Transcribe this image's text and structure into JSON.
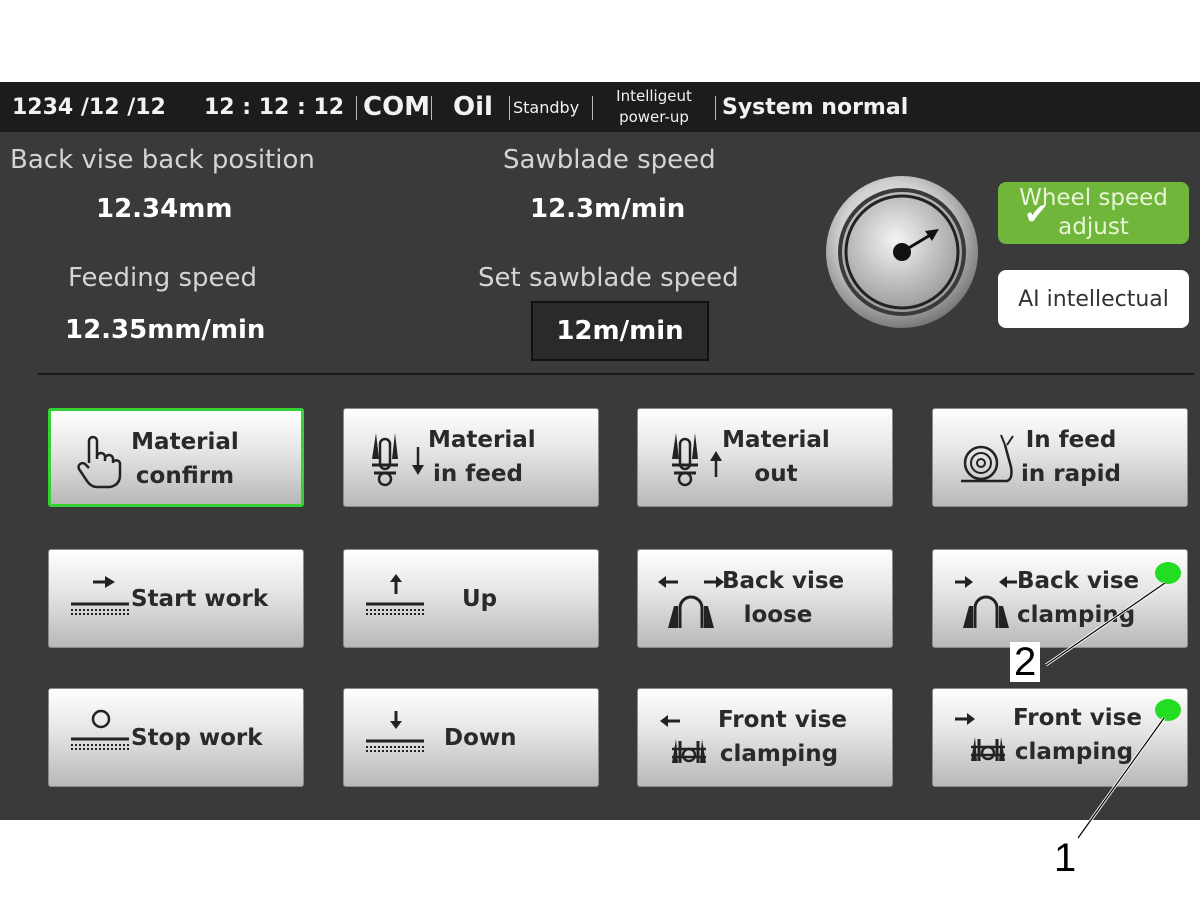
{
  "status_bar": {
    "date": "1234 /12 /12",
    "time": "12 : 12 : 12",
    "com": "COM",
    "oil": "Oil",
    "standby": "Standby",
    "power_up_line1": "Intelligeut",
    "power_up_line2": "power-up",
    "system": "System normal"
  },
  "readouts": {
    "back_vise_label": "Back vise back position",
    "back_vise_value": "12.34mm",
    "sawblade_label": "Sawblade speed",
    "sawblade_value": "12.3m/min",
    "feeding_label": "Feeding speed",
    "feeding_value": "12.35mm/min",
    "set_sawblade_label": "Set sawblade speed",
    "set_sawblade_value": "12m/min"
  },
  "side_buttons": {
    "wheel_line1": "Wheel speed",
    "wheel_line2": "adjust",
    "ai": "AI intellectual"
  },
  "buttons": [
    {
      "line1": "Material",
      "line2": "confirm",
      "icon": "hand-pointer-icon"
    },
    {
      "line1": "Material",
      "line2": "in feed",
      "icon": "material-in-icon"
    },
    {
      "line1": "Material",
      "line2": "out",
      "icon": "material-out-icon"
    },
    {
      "line1": "In feed",
      "line2": "in rapid",
      "icon": "snail-icon"
    },
    {
      "line1": "Start work",
      "icon": "start-work-icon"
    },
    {
      "line1": "Up",
      "icon": "blade-up-icon"
    },
    {
      "line1": "Back vise",
      "line2": "loose",
      "icon": "vise-loose-icon"
    },
    {
      "line1": "Back vise",
      "line2": "clamping",
      "icon": "vise-clamp-icon"
    },
    {
      "line1": "Stop work",
      "icon": "stop-work-icon"
    },
    {
      "line1": "Down",
      "icon": "blade-down-icon"
    },
    {
      "line1": "Front vise",
      "line2": "clamping",
      "icon": "front-vise-left-icon"
    },
    {
      "line1": "Front vise",
      "line2": "clamping",
      "icon": "front-vise-right-icon"
    }
  ],
  "callouts": {
    "one": "1",
    "two": "2"
  },
  "colors": {
    "indicator": "#22dd22",
    "selected_border": "#35d135",
    "wheel_button": "#6fb63a"
  }
}
